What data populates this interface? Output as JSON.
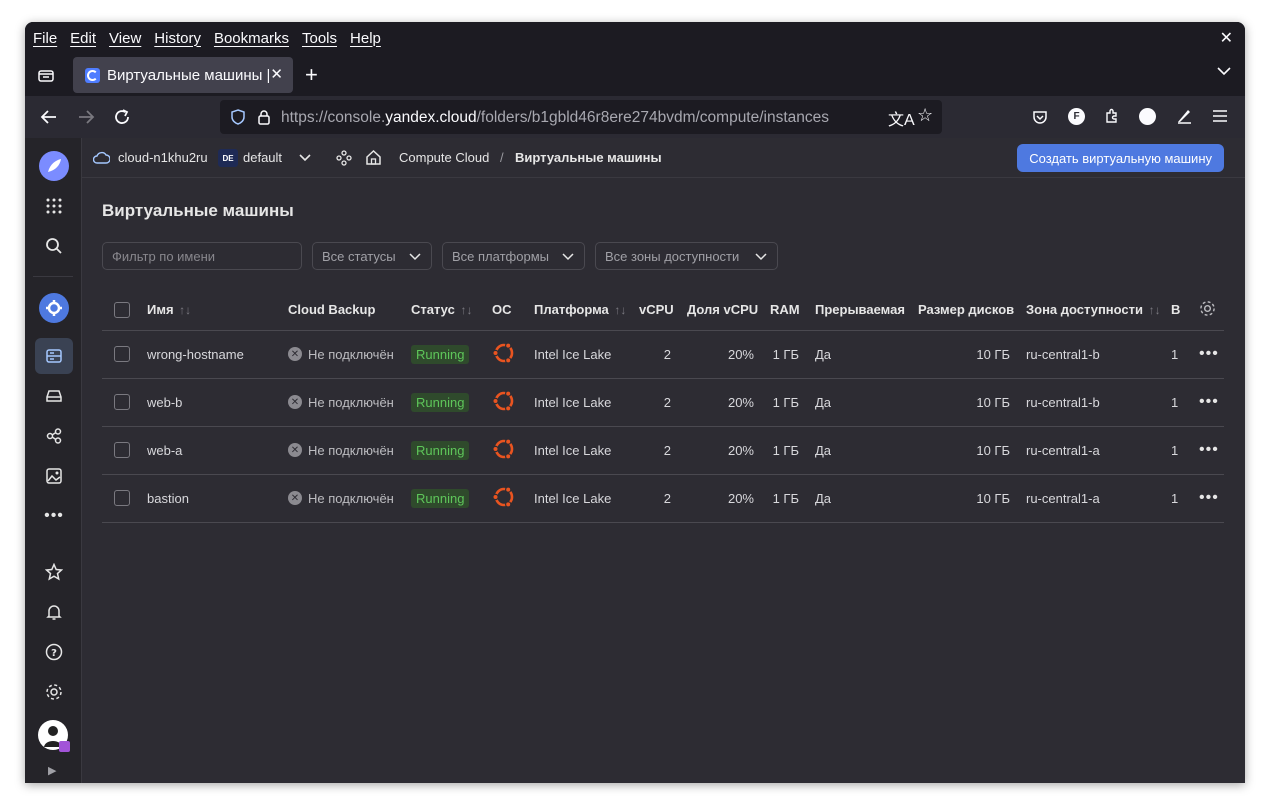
{
  "menubar": {
    "items": [
      "File",
      "Edit",
      "View",
      "History",
      "Bookmarks",
      "Tools",
      "Help"
    ]
  },
  "tab": {
    "title": "Виртуальные машины |"
  },
  "url": {
    "prefix": "https://console.",
    "domain": "yandex.cloud",
    "path": "/folders/b1gbld46r8ere274bvdm/compute/instances"
  },
  "header": {
    "cloud": "cloud-n1khu2ru",
    "folder_badge": "DE",
    "folder": "default",
    "service": "Compute Cloud",
    "separator": "/",
    "current": "Виртуальные машины",
    "create_button": "Создать виртуальную машину"
  },
  "page_title": "Виртуальные машины",
  "filters": {
    "name_placeholder": "Фильтр по имени",
    "status": "Все статусы",
    "platform": "Все платформы",
    "zone": "Все зоны доступности"
  },
  "table": {
    "columns": {
      "name": "Имя",
      "backup": "Cloud Backup",
      "status": "Статус",
      "os": "ОС",
      "platform": "Платформа",
      "vcpu": "vCPU",
      "vcpu_share": "Доля vCPU",
      "ram": "RAM",
      "preemptible": "Прерываемая",
      "disk": "Размер дисков",
      "zone": "Зона доступности",
      "extra": "В"
    },
    "rows": [
      {
        "name": "wrong-hostname",
        "backup": "Не подключён",
        "status": "Running",
        "platform": "Intel Ice Lake",
        "vcpu": "2",
        "vcpu_share": "20%",
        "ram": "1 ГБ",
        "preemptible": "Да",
        "disk": "10 ГБ",
        "zone": "ru-central1-b",
        "extra": "1"
      },
      {
        "name": "web-b",
        "backup": "Не подключён",
        "status": "Running",
        "platform": "Intel Ice Lake",
        "vcpu": "2",
        "vcpu_share": "20%",
        "ram": "1 ГБ",
        "preemptible": "Да",
        "disk": "10 ГБ",
        "zone": "ru-central1-b",
        "extra": "1"
      },
      {
        "name": "web-a",
        "backup": "Не подключён",
        "status": "Running",
        "platform": "Intel Ice Lake",
        "vcpu": "2",
        "vcpu_share": "20%",
        "ram": "1 ГБ",
        "preemptible": "Да",
        "disk": "10 ГБ",
        "zone": "ru-central1-a",
        "extra": "1"
      },
      {
        "name": "bastion",
        "backup": "Не подключён",
        "status": "Running",
        "platform": "Intel Ice Lake",
        "vcpu": "2",
        "vcpu_share": "20%",
        "ram": "1 ГБ",
        "preemptible": "Да",
        "disk": "10 ГБ",
        "zone": "ru-central1-a",
        "extra": "1"
      }
    ]
  },
  "colors": {
    "accent": "#4e79e0",
    "running": "#5ec65a",
    "ubuntu": "#e95420"
  },
  "icons": [
    "close-icon",
    "tab-list-icon",
    "plus-icon",
    "chevron-down-icon",
    "back-icon",
    "forward-icon",
    "reload-icon",
    "shield-icon",
    "lock-icon",
    "translate-icon",
    "star-icon",
    "pocket-icon",
    "account-icon",
    "extensions-icon",
    "hamburger-icon",
    "cloud-icon",
    "home-icon",
    "ubuntu-icon",
    "settings-icon",
    "more-icon"
  ]
}
